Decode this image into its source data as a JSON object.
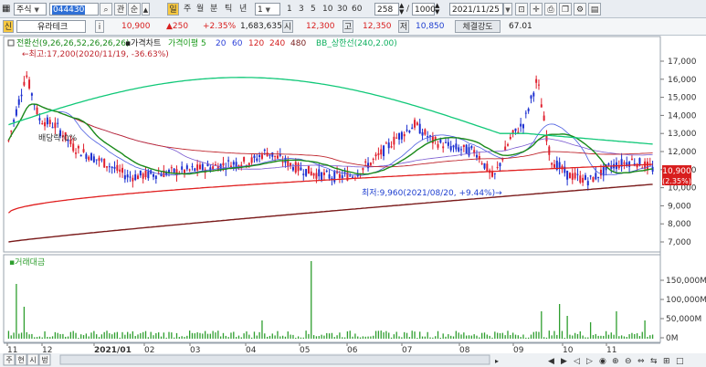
{
  "toolbar": {
    "menu_icon": "grid-icon",
    "market": "주식",
    "code": "044430",
    "search_icon": "search-icon",
    "b_gwan": "관",
    "b_rank": "순",
    "period_il": "일",
    "period_ju": "주",
    "period_wol": "월",
    "period_bun": "분",
    "period_tik": "틱",
    "period_nyeon": "년",
    "interval_value": "1",
    "n1": "1",
    "n3": "3",
    "n5": "5",
    "n10": "10",
    "n30": "30",
    "n60": "60",
    "count": "258",
    "divider": "/",
    "total": "1000",
    "date": "2021/11/25",
    "tool_icons": [
      "chart-search-icon",
      "crosshair-icon",
      "print-icon",
      "copy-icon",
      "settings-icon",
      "save-icon"
    ]
  },
  "quote": {
    "badge": "신",
    "name": "유라테크",
    "info_btn": "i",
    "price": "10,900",
    "change": "▲250",
    "change_pct": "+2.35%",
    "volume": "1,683,635",
    "open_label": "시",
    "open": "12,300",
    "high_label": "고",
    "high": "12,350",
    "low_label": "저",
    "low": "10,850",
    "strength_label": "체결강도",
    "strength": "67.01"
  },
  "legend": {
    "items": [
      {
        "text": "전환선(9,26,26,52,26,26,26)",
        "color": "#1a8a1a"
      },
      {
        "text": "가격차트",
        "color": "#222222"
      },
      {
        "text": "가격이평 5",
        "color": "#1a9a1a"
      },
      {
        "text": "20",
        "color": "#2a3fd8"
      },
      {
        "text": "60",
        "color": "#2a3fd8"
      },
      {
        "text": "120",
        "color": "#d42020"
      },
      {
        "text": "240",
        "color": "#d42020"
      },
      {
        "text": "480",
        "color": "#7a2020"
      },
      {
        "text": "BB_상한선(240,2.00)",
        "color": "#10b060"
      }
    ]
  },
  "annotations": {
    "high": "←최고:17,200(2020/11/19, -36.63%)",
    "low": "최저:9,960(2021/08/20, +9.44%)→",
    "multiplier": "배당락:0%"
  },
  "price_axis": [
    "17,000",
    "16,000",
    "15,000",
    "14,000",
    "13,000",
    "12,000",
    "11,000",
    "10,000",
    "9,000",
    "8,000",
    "7,000"
  ],
  "price_tags": {
    "current": "10,900",
    "change": "(2.35%)"
  },
  "volume_panel": {
    "label": "거래대금",
    "axis": [
      "150,000M",
      "100,000M",
      "50,000M",
      "0M"
    ]
  },
  "x_axis": [
    "11",
    "12",
    "2021/01",
    "02",
    "03",
    "04",
    "05",
    "06",
    "07",
    "08",
    "09",
    "10",
    "11"
  ],
  "bottom_tabs": [
    "주",
    "현",
    "시",
    "벙"
  ],
  "colors": {
    "up": "#e0202e",
    "down": "#1c2fd0",
    "ichimoku": "#1a8a1a",
    "bollinger": "#10c878",
    "ma240": "#e02020",
    "ma480": "#7a1a1a",
    "volume": "#2e9e2e"
  }
}
